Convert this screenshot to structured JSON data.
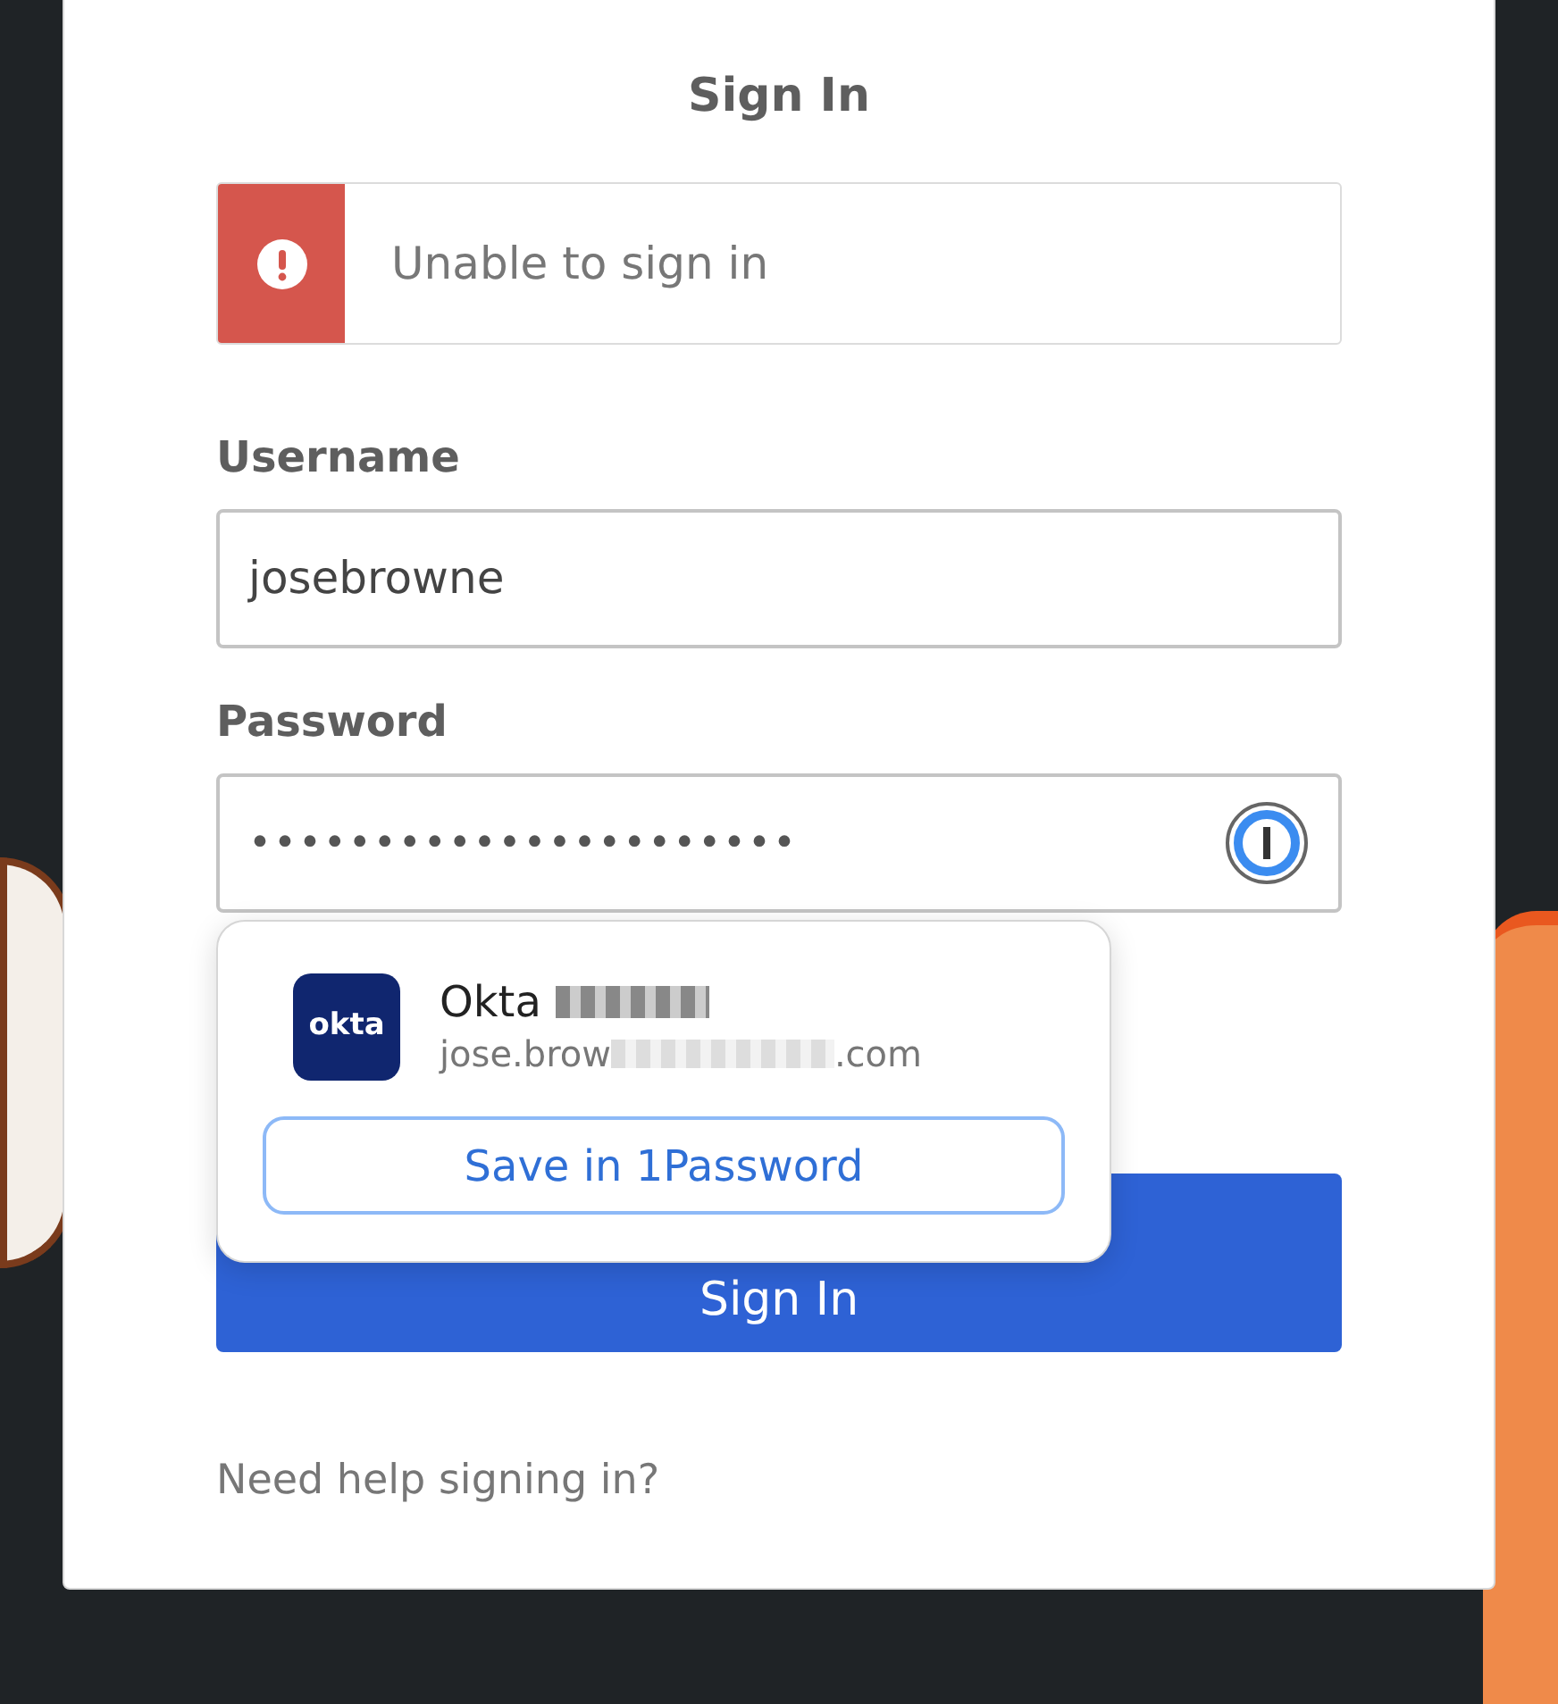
{
  "form": {
    "title": "Sign In",
    "error": {
      "message": "Unable to sign in"
    },
    "fields": [
      {
        "label": "Username",
        "value": "josebrowne",
        "kind": "text"
      },
      {
        "label": "Password",
        "value": "••••••••••••••••••••••",
        "kind": "password"
      }
    ],
    "submit": "Sign In",
    "help_link": "Need help signing in?"
  },
  "password_popup": {
    "logo_text": "okta",
    "account_name": "Okta",
    "email_start": "jose.brow",
    "email_end": ".com",
    "save_button": "Save in 1Password"
  }
}
